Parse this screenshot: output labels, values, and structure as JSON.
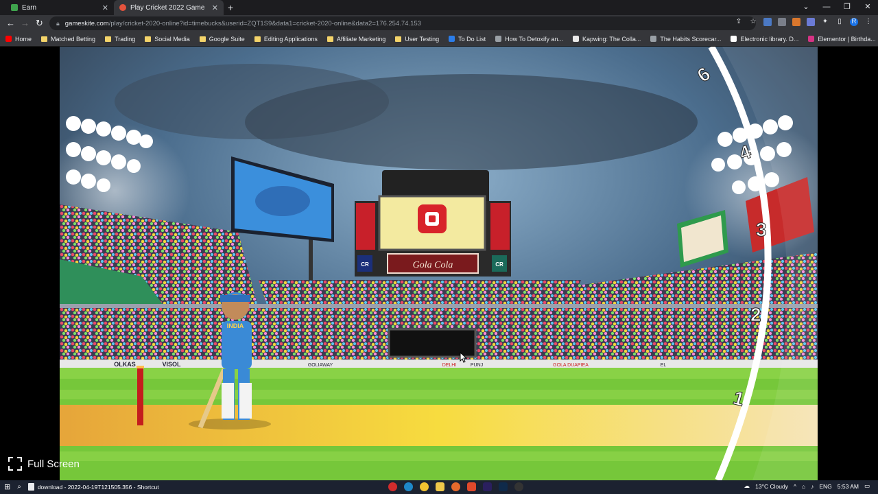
{
  "browser": {
    "tabs": [
      {
        "label": "Earn",
        "active": false
      },
      {
        "label": "Play Cricket 2022 Game",
        "active": true
      }
    ],
    "url_host": "gameskite.com",
    "url_path": "/play/cricket-2020-online?id=timebucks&userid=ZQT1S9&data1=cricket-2020-online&data2=176.254.74.153",
    "bookmarks": [
      {
        "label": "Home",
        "icon": "youtube-icon"
      },
      {
        "label": "Matched Betting",
        "icon": "folder-icon"
      },
      {
        "label": "Trading",
        "icon": "folder-icon"
      },
      {
        "label": "Social Media",
        "icon": "folder-icon"
      },
      {
        "label": "Google Suite",
        "icon": "folder-icon"
      },
      {
        "label": "Editing Applications",
        "icon": "folder-icon"
      },
      {
        "label": "Affiliate Marketing",
        "icon": "folder-icon"
      },
      {
        "label": "User Testing",
        "icon": "folder-icon"
      },
      {
        "label": "To Do List",
        "icon": "todo-icon"
      },
      {
        "label": "How To Detoxify an...",
        "icon": "page-icon"
      },
      {
        "label": "Kapwing: The Colla...",
        "icon": "kapwing-icon"
      },
      {
        "label": "The Habits Scorecar...",
        "icon": "page-icon"
      },
      {
        "label": "Electronic library. D...",
        "icon": "library-icon"
      },
      {
        "label": "Elementor | Birthda...",
        "icon": "elementor-icon"
      }
    ]
  },
  "game": {
    "billboard_brand": "Gola Cola",
    "cr_badge": "CR",
    "player_jersey": "INDIA",
    "score_markers": [
      "6",
      "4",
      "3",
      "2",
      "1"
    ],
    "hoardings": [
      "OLKAS",
      "VISOL",
      "GOLIAWAY",
      "DELHI",
      "PUNJ",
      "GOLA DUAPIEA",
      "EL"
    ],
    "fullscreen_label": "Full Screen"
  },
  "taskbar": {
    "download_item": "download - 2022-04-19T121505.356 - Shortcut",
    "weather": "13°C Cloudy",
    "language": "ENG",
    "time": "5:53 AM"
  },
  "colors": {
    "chrome_bg": "#202124",
    "pitch": "#f2c84b",
    "grass": "#76c73a",
    "sky": "#5f86a8"
  }
}
